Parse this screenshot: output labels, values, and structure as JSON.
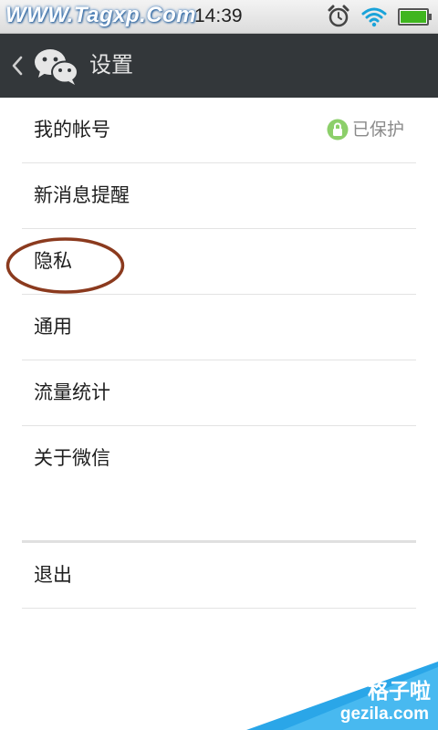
{
  "status_bar": {
    "watermark": "WWW.Tagxp.Com",
    "time": "14:39",
    "icons": [
      "alarm-icon",
      "wifi-icon",
      "battery-icon"
    ],
    "battery_level": 1.0
  },
  "header": {
    "back_icon": "chevron-left-icon",
    "logo_icon": "wechat-logo-icon",
    "title": "设置"
  },
  "settings": {
    "items": [
      {
        "label": "我的帐号",
        "value": "已保护",
        "value_icon": "lock-icon"
      },
      {
        "label": "新消息提醒"
      },
      {
        "label": "隐私"
      },
      {
        "label": "通用"
      },
      {
        "label": "流量统计"
      },
      {
        "label": "关于微信"
      }
    ],
    "logout": {
      "label": "退出"
    }
  },
  "watermark_corner": {
    "cn": "格子啦",
    "en": "gezila.com"
  },
  "colors": {
    "header_bg": "#33373a",
    "annotation": "#8b3a1e",
    "protected_green": "#8ccf6a",
    "corner_blue": "#2aa6e8"
  }
}
